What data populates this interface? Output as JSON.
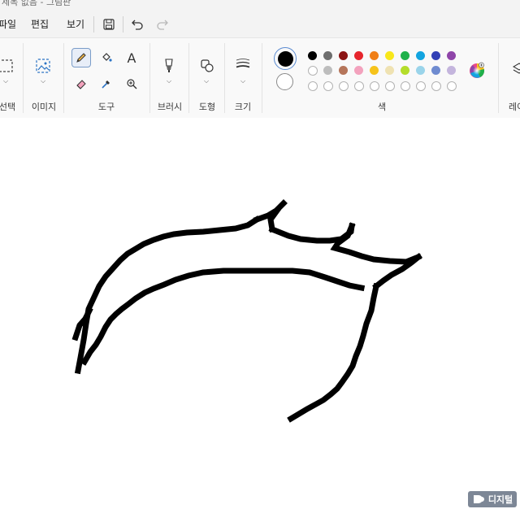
{
  "window": {
    "title": "제목 없음 - 그림판"
  },
  "menu": {
    "file": "파일",
    "edit": "편집",
    "view": "보기"
  },
  "ribbon": {
    "groups": {
      "select": "선택",
      "image": "이미지",
      "tools": "도구",
      "brushes": "브러시",
      "shapes": "도형",
      "size": "크기",
      "colors": "색",
      "layers": "레이"
    },
    "text_tool_glyph": "A"
  },
  "colors": {
    "primary": "#000000",
    "secondary": "#ffffff",
    "row1": [
      "#000000",
      "#6e6e6e",
      "#8b1414",
      "#e6252c",
      "#f07f16",
      "#f8e71a",
      "#1fb14a",
      "#12a4e0",
      "#3240b6",
      "#8f45a9"
    ],
    "row2": [
      "#ffffff",
      "#bdbdbd",
      "#b5755a",
      "#f3a2bd",
      "#f6c31b",
      "#efe2b2",
      "#b4dd2a",
      "#9ad4ea",
      "#6f8bd0",
      "#c4b5dd"
    ],
    "row3_count": 10
  },
  "watermark": {
    "text": "디지털"
  }
}
